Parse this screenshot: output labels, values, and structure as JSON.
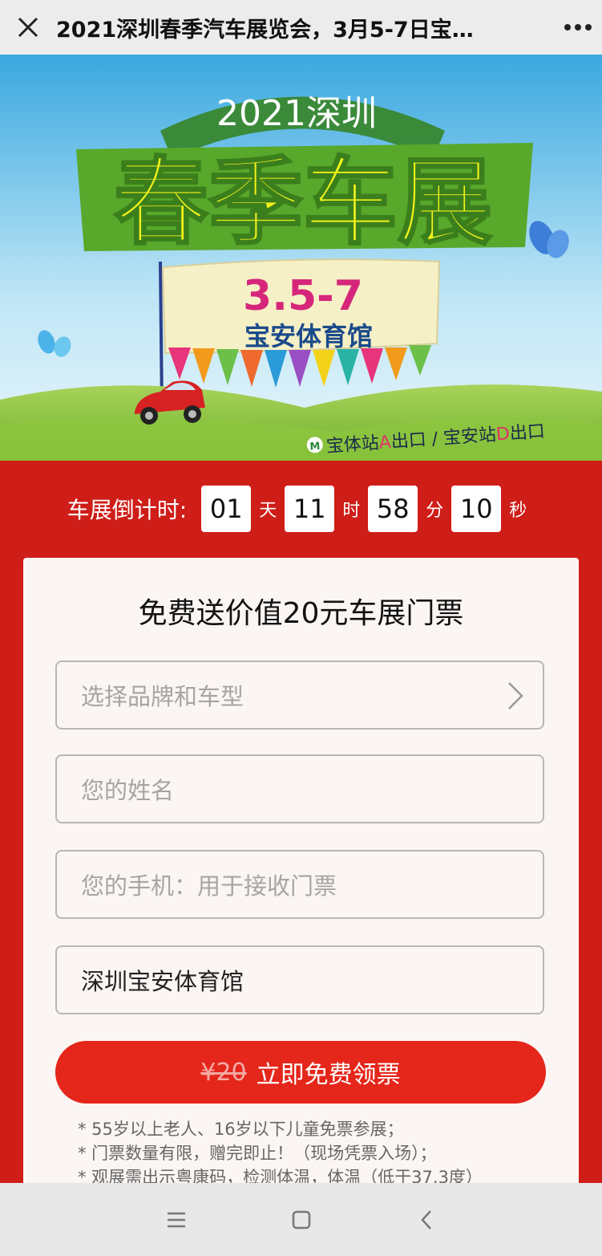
{
  "header": {
    "title": "2021深圳春季汽车展览会，3月5-7日宝…"
  },
  "banner": {
    "top_text": "2021深圳",
    "main_text": "春季车展",
    "date": "3.5-7",
    "venue": "宝安体育馆",
    "metro_a_prefix": "宝体站",
    "metro_a_letter": "A",
    "metro_a_suffix": "出口 / 宝安站",
    "metro_d_letter": "D",
    "metro_d_suffix": "出口"
  },
  "countdown": {
    "label": "车展倒计时:",
    "days": "01",
    "days_unit": "天",
    "hours": "11",
    "hours_unit": "时",
    "minutes": "58",
    "minutes_unit": "分",
    "seconds": "10",
    "seconds_unit": "秒"
  },
  "form": {
    "title": "免费送价值20元车展门票",
    "brand_placeholder": "选择品牌和车型",
    "name_placeholder": "您的姓名",
    "phone_placeholder": "您的手机：用于接收门票",
    "venue_value": "深圳宝安体育馆",
    "original_price": "¥20",
    "claim_label": "立即免费领票"
  },
  "notes": [
    "* 55岁以上老人、16岁以下儿童免票参展；",
    "* 门票数量有限，赠完即止！（现场凭票入场）；",
    "* 观展需出示粤康码，检测体温，体温（低于37.3度）"
  ],
  "colors": {
    "page_red": "#cf1d18",
    "button_red": "#e5261b",
    "card_bg": "#fbf6f3"
  },
  "icons": {
    "close": "close-icon",
    "more": "more-icon",
    "chevron": "chevron-right-icon",
    "menu": "menu-icon",
    "home": "home-icon",
    "back": "back-icon"
  }
}
